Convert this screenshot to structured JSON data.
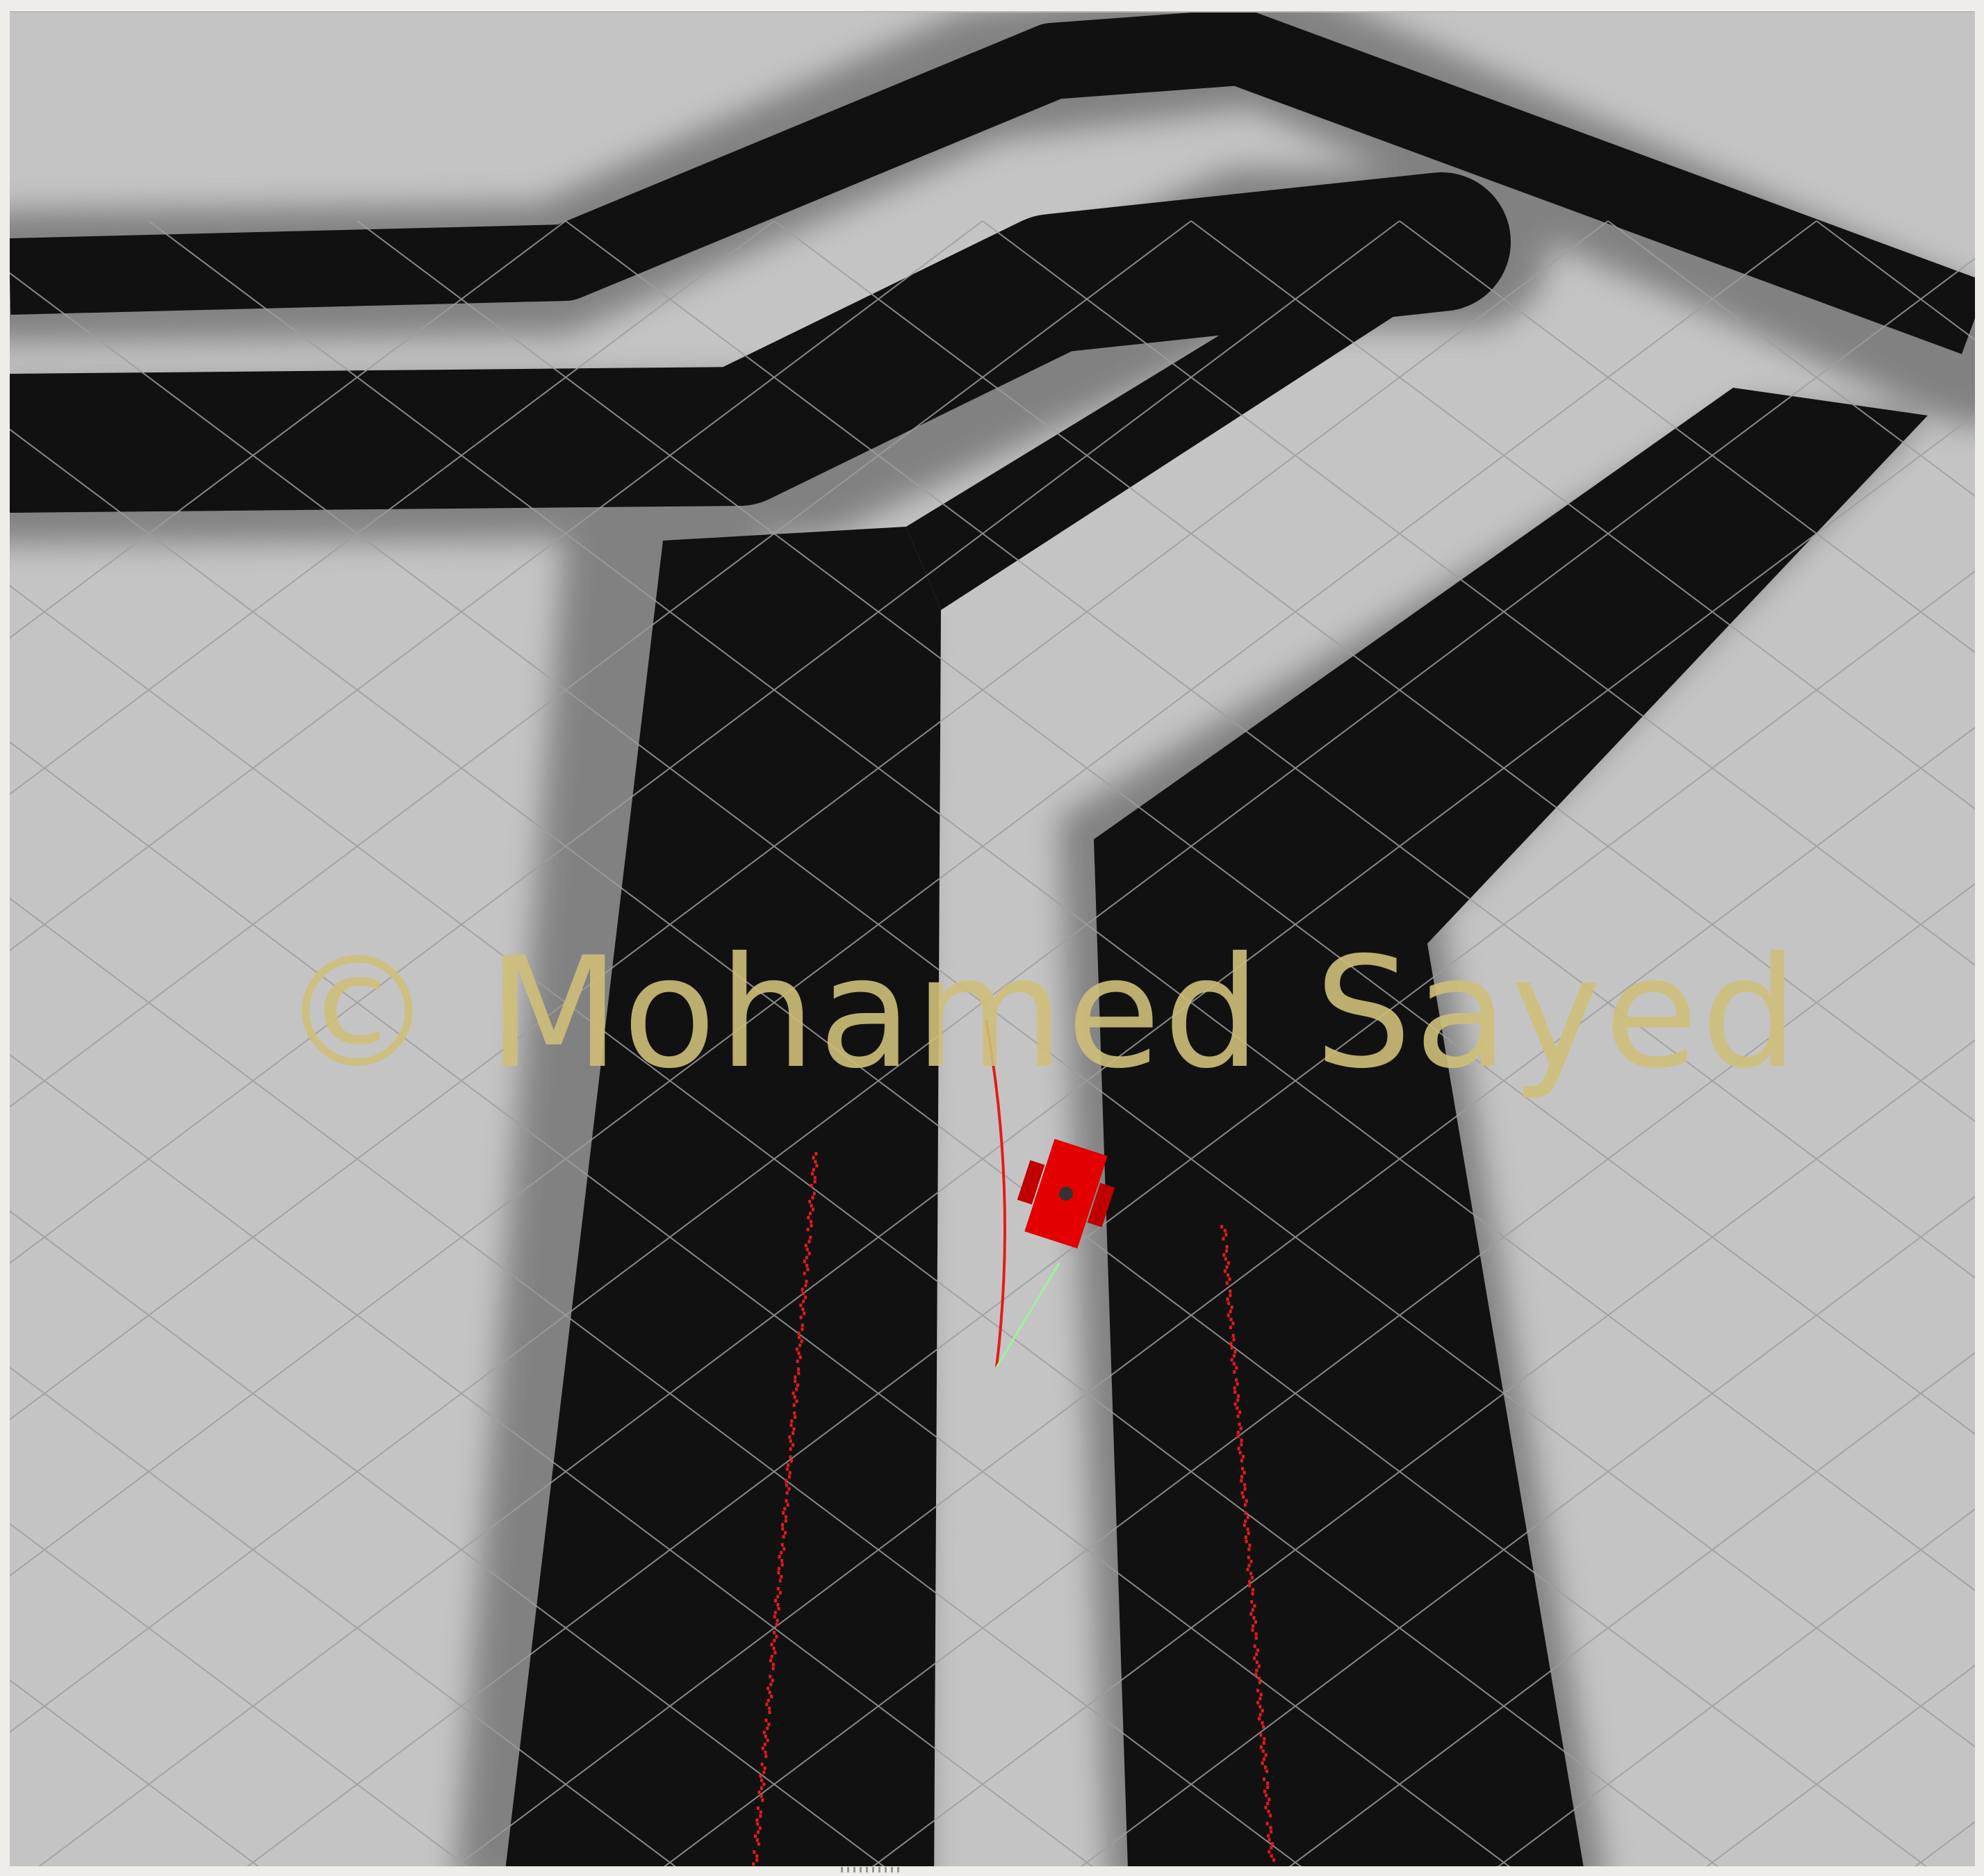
{
  "viewport": {
    "background_color": "#c4c4c4",
    "obstacle_color": "#111111",
    "inflation_color": "#8a8a8a",
    "grid_color": "#9e9e9e",
    "scan_color": "#e31b1b",
    "robot_color": "#e30000",
    "path_color": "#9cf29c"
  },
  "watermark": {
    "text": "© Mohamed Sayed",
    "color": "#cfbf7a"
  },
  "statusbar": {
    "handle_icon": "resize-grip-icon"
  }
}
